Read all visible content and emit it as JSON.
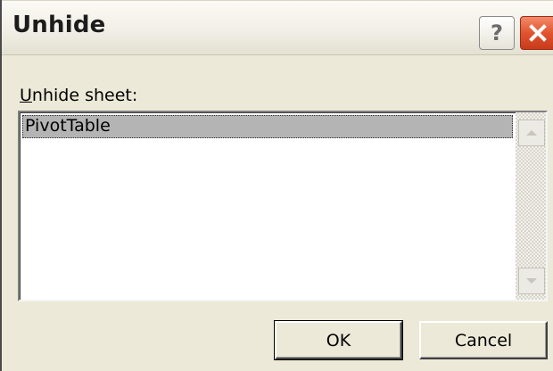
{
  "dialog": {
    "title": "Unhide",
    "help_glyph": "?",
    "help_icon": "help-icon",
    "close_icon": "close-icon",
    "label_accesskey": "U",
    "label_rest": "nhide sheet:",
    "sheets": [
      "PivotTable"
    ],
    "selected_index": 0,
    "scroll_up_icon": "scroll-up-arrow-icon",
    "scroll_down_icon": "scroll-down-arrow-icon",
    "ok_label": "OK",
    "cancel_label": "Cancel",
    "colors": {
      "face": "#ece9d8",
      "close_button": "#e1532f",
      "selection": "#b4b4b4"
    }
  }
}
